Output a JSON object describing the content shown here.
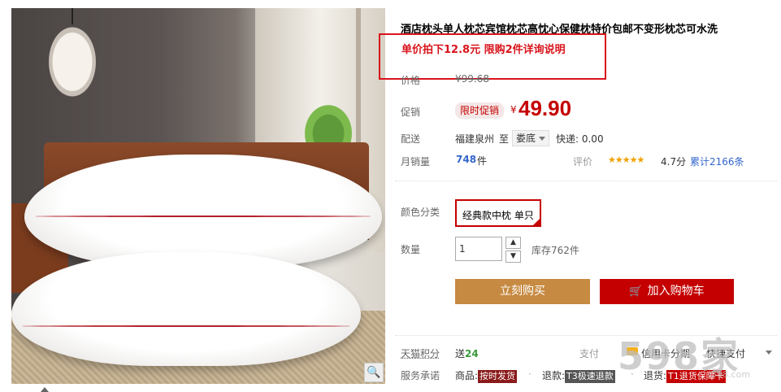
{
  "product": {
    "title": "酒店枕头单人枕芯宾馆枕芯高忱心保健枕特价包邮不变形枕芯可水洗",
    "promo_note": "单价拍下12.8元 限购2件详询说明"
  },
  "price": {
    "label": "价格",
    "original": "¥99.68",
    "promo_label": "促销",
    "promo_tag": "限时促销",
    "currency": "¥",
    "current": "49.90"
  },
  "shipping": {
    "label": "配送",
    "from": "福建泉州",
    "to_word": "至",
    "destination": "娄底",
    "fee": "快递: 0.00"
  },
  "sales": {
    "label": "月销量",
    "count": "748",
    "unit": "件",
    "rating_label": "评价",
    "stars": "★★★★★",
    "rating_fraction": 0.94,
    "score": "4.7分",
    "reviews": "累计2166条"
  },
  "sku": {
    "label": "颜色分类",
    "option": "经典款中枕 单只"
  },
  "quantity": {
    "label": "数量",
    "value": "1",
    "up": "▲",
    "down": "▼",
    "stock": "库存762件"
  },
  "buttons": {
    "buy": "立刻购买",
    "cart": "加入购物车",
    "cart_icon": "🛒"
  },
  "points": {
    "label": "天猫积分",
    "prefix": "送",
    "value": "24"
  },
  "payment": {
    "label": "支付",
    "credit": "信用卡分期",
    "quick": "快捷支付"
  },
  "service": {
    "label": "服务承诺",
    "goods_label": "商品:",
    "goods_badge": "按时发货",
    "refund_label": "退款:",
    "refund_badge": "T3极速退款",
    "return_label": "退货:",
    "return_badge": "T1退货保障卡"
  },
  "zoom_icon": "magnifier-icon",
  "zoom_glyph": "🔍",
  "watermark": {
    "big": "598家",
    "small": "j598.com"
  },
  "colors": {
    "accent_red": "#c40000",
    "promo_red": "#d9141c",
    "buy_button": "#c78a42",
    "link_blue": "#3366cc"
  }
}
